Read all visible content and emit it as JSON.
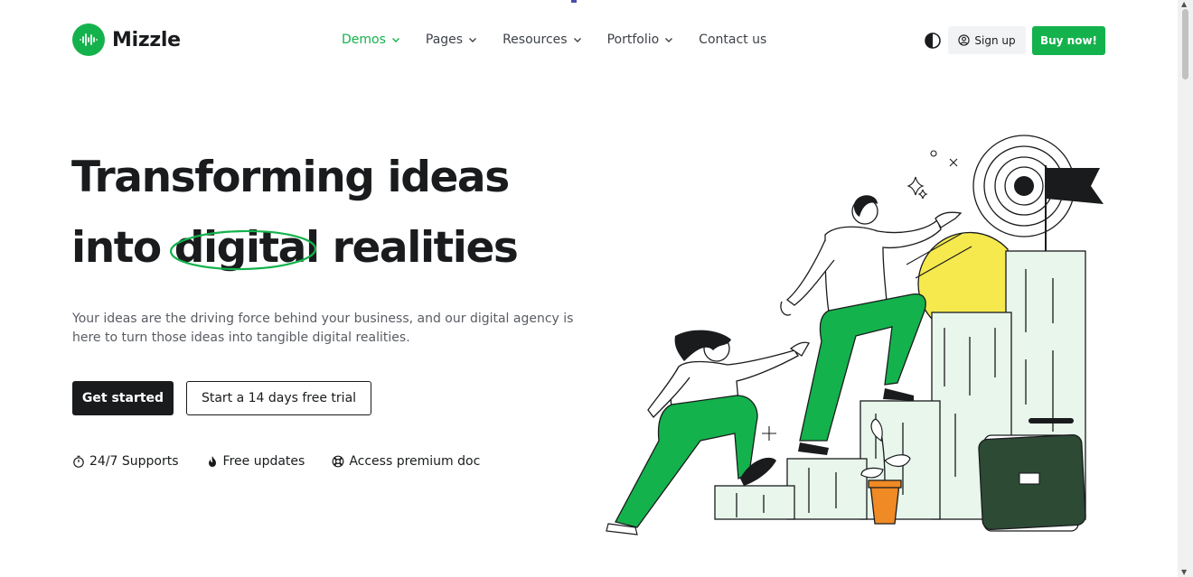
{
  "brand": {
    "name": "Mizzle",
    "accent": "#14b24c",
    "dark": "#191b1d"
  },
  "nav": {
    "items": [
      {
        "label": "Demos",
        "has_dropdown": true,
        "active": true
      },
      {
        "label": "Pages",
        "has_dropdown": true,
        "active": false
      },
      {
        "label": "Resources",
        "has_dropdown": true,
        "active": false
      },
      {
        "label": "Portfolio",
        "has_dropdown": true,
        "active": false
      },
      {
        "label": "Contact us",
        "has_dropdown": false,
        "active": false
      }
    ]
  },
  "header_actions": {
    "theme_icon": "contrast-icon",
    "signup_label": "Sign up",
    "signup_icon": "user-circle-icon",
    "buy_label": "Buy now!"
  },
  "hero": {
    "title_line1": "Transforming ideas",
    "title_line2_prefix": "into ",
    "title_highlight": "digital",
    "title_line2_suffix": " realities",
    "description": "Your ideas are the driving force behind your business, and our digital agency is here to turn those ideas into tangible digital realities.",
    "primary_cta": "Get started",
    "secondary_cta": "Start a 14 days free trial"
  },
  "features": [
    {
      "icon": "stopwatch-icon",
      "label": "24/7 Supports"
    },
    {
      "icon": "fire-icon",
      "label": "Free updates"
    },
    {
      "icon": "lifebuoy-icon",
      "label": "Access premium doc"
    }
  ]
}
